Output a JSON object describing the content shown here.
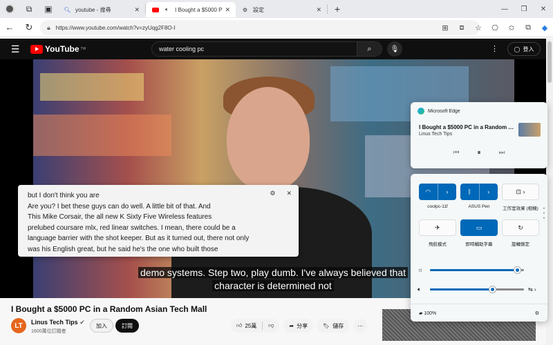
{
  "tabs": [
    {
      "title": "youtube - 搜尋",
      "active": false
    },
    {
      "title": "I Bought a $5000 P",
      "active": true
    },
    {
      "title": "設定",
      "active": false
    }
  ],
  "address": {
    "url": "https://www.youtube.com/watch?v=zyUqg2F8O-I"
  },
  "youtube": {
    "logo_text": "YouTube",
    "region": "TW",
    "search_query": "water cooling pc",
    "signin_label": "登入"
  },
  "video": {
    "subtitle_lines": [
      "demo systems. Step two, play dumb. I've always believed that",
      "character is determined not"
    ],
    "title": "I Bought a $5000 PC in a Random Asian Tech Mall",
    "channel_name": "Linus Tech Tips",
    "subscribers": "1600萬位訂閱者",
    "join_label": "加入",
    "subscribe_label": "訂閱",
    "likes": "25萬",
    "share_label": "分享",
    "save_label": "儲存"
  },
  "live_caption": {
    "lines": [
      "but I don't think you are",
      "Are you? I bet these guys can do well. A little bit of that. And",
      "This Mike Corsair, the all new K Sixty Five Wireless features",
      "prelubed coursare mlx, red linear switches. I mean, there could be a",
      "language barrier with the shot keeper. But as it turned out, there not only",
      "was his English great, but he said he's the one who built those"
    ]
  },
  "media_flyout": {
    "source": "Microsoft Edge",
    "title": "I Bought a $5000 PC in a Random As...",
    "artist": "Linus Tech Tips"
  },
  "quick_settings": {
    "tiles": [
      {
        "label": "coolpc-11f",
        "on": true,
        "icon": "wifi-icon"
      },
      {
        "label": "ASUS Pen",
        "on": true,
        "icon": "bluetooth-icon"
      },
      {
        "label": "工作室效果 (相機)",
        "on": false,
        "icon": "studio-effects-icon"
      },
      {
        "label": "飛航模式",
        "on": false,
        "icon": "airplane-icon"
      },
      {
        "label": "即時輔助字幕",
        "on": true,
        "icon": "live-captions-icon"
      },
      {
        "label": "旋轉鎖定",
        "on": false,
        "icon": "rotation-lock-icon"
      }
    ],
    "brightness": 0.93,
    "volume": 0.66,
    "battery": "100%"
  },
  "colors": {
    "accent": "#0068b8",
    "yt_red": "#ff0000"
  }
}
